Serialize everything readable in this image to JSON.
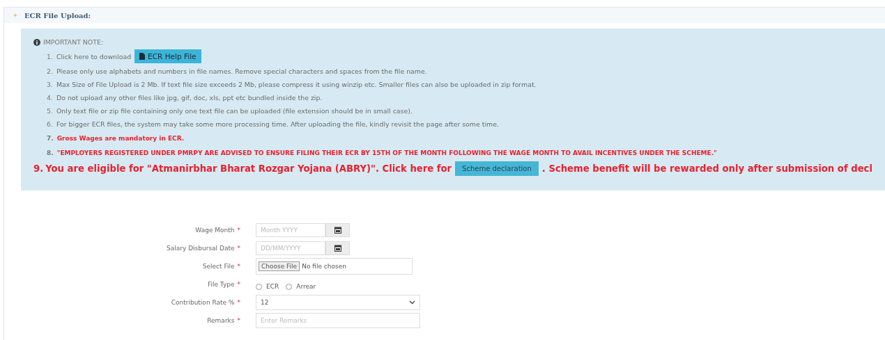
{
  "panel": {
    "title": "ECR File Upload:",
    "expanded": true
  },
  "note": {
    "heading": "IMPORTANT NOTE:",
    "items": [
      {
        "kind": "download",
        "number": "1.",
        "text": "Click here to download",
        "button": "ECR Help File"
      },
      {
        "kind": "plain",
        "number": "2.",
        "text": "Please only use alphabets and numbers in file names. Remove special characters and spaces from the file name."
      },
      {
        "kind": "plain",
        "number": "3.",
        "text": "Max Size of File Upload is 2 Mb. If text file size exceeds 2 Mb, please compress it using winzip etc. Smaller files can also be uploaded in zip format."
      },
      {
        "kind": "plain",
        "number": "4.",
        "text": "Do not upload any other files like jpg, gif, doc, xls, ppt etc bundled inside the zip."
      },
      {
        "kind": "plain",
        "number": "5.",
        "text": "Only text file or zip file containing only one text file can be uploaded (file extension should be in small case)."
      },
      {
        "kind": "plain",
        "number": "6.",
        "text": "For bigger ECR files, the system may take some more processing time. After uploading the file, kindly revisit the page after some time."
      },
      {
        "kind": "alert",
        "number": "7.",
        "text": "Gross Wages are mandatory in ECR."
      },
      {
        "kind": "alert",
        "number": "8.",
        "text": "\"EMPLOYERS REGISTERED UNDER PMRPY ARE ADVISED TO ENSURE FILING THEIR ECR BY 15TH OF THE MONTH FOLLOWING THE WAGE MONTH TO AVAIL INCENTIVES UNDER THE SCHEME.\""
      },
      {
        "kind": "scheme",
        "number": "9.",
        "text": "You are eligible for \"Atmanirbhar Bharat Rozgar Yojana (ABRY)\". Click here for",
        "button": "Scheme declaration",
        "after": ". Scheme benefit will be rewarded only after submission of decl"
      }
    ]
  },
  "form": [
    {
      "kind": "month",
      "label": "Wage Month",
      "required_mark": "*",
      "placeholder": "Month YYYY"
    },
    {
      "kind": "date",
      "label": "Salary Disbursal Date",
      "required_mark": "*",
      "placeholder": "DD/MM/YYYY"
    },
    {
      "kind": "file",
      "label": "Select File",
      "required_mark": "*",
      "button": "Choose File",
      "status": "No file chosen"
    },
    {
      "kind": "radio",
      "label": "File Type",
      "required_mark": "*",
      "options": [
        {
          "label": "ECR",
          "selected": false
        },
        {
          "label": "Arrear",
          "selected": false
        }
      ]
    },
    {
      "kind": "select",
      "label": "Contribution Rate %",
      "required_mark": "*",
      "value": "12"
    },
    {
      "kind": "text",
      "label": "Remarks",
      "required_mark": "*",
      "placeholder": "Enter Remarks"
    }
  ]
}
